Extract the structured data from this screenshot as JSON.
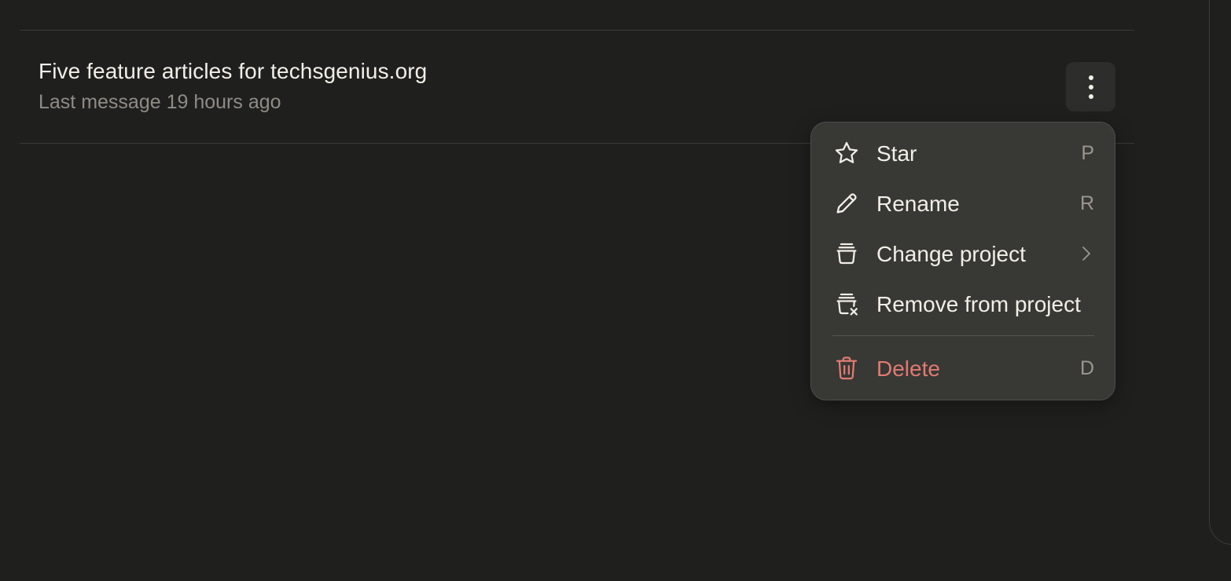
{
  "chat": {
    "title": "Five feature articles for techsgenius.org",
    "meta": "Last message 19 hours ago",
    "more_icon": "vertical-ellipsis-icon"
  },
  "menu": {
    "items": [
      {
        "label": "Star",
        "shortcut": "P",
        "icon": "star-icon"
      },
      {
        "label": "Rename",
        "shortcut": "R",
        "icon": "pencil-icon"
      },
      {
        "label": "Change project",
        "icon": "project-box-icon",
        "submenu_icon": "chevron-right-icon"
      },
      {
        "label": "Remove from project",
        "icon": "project-remove-icon"
      },
      {
        "label": "Delete",
        "shortcut": "D",
        "icon": "trash-icon",
        "color": "#e07b72"
      }
    ]
  },
  "colors": {
    "background": "#1f1f1e",
    "menu_background": "#383835",
    "text": "#f2efe7",
    "muted_text": "#8f8c85",
    "danger": "#e07b72"
  }
}
